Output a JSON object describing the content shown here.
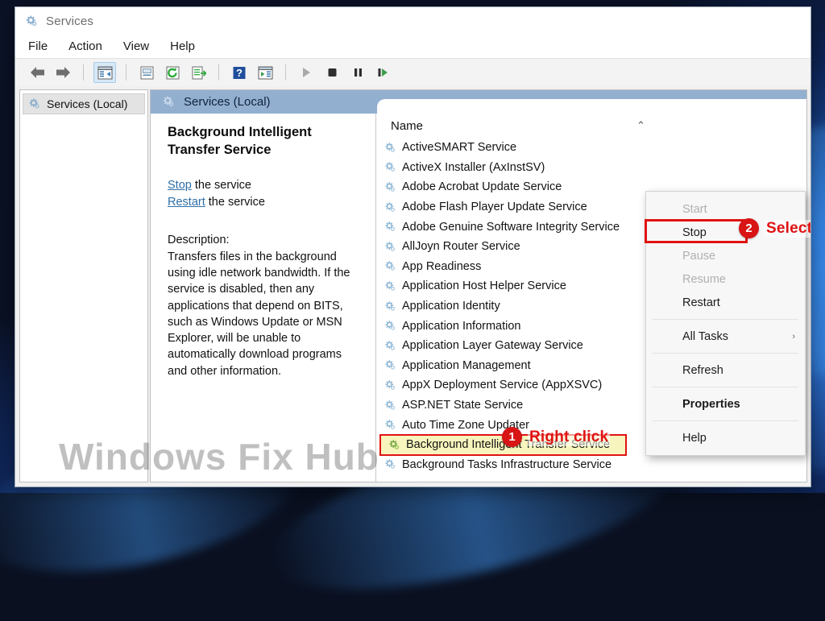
{
  "window": {
    "title": "Services",
    "title_icon": "services-gear-icon"
  },
  "menubar": {
    "items": [
      {
        "label": "File"
      },
      {
        "label": "Action"
      },
      {
        "label": "View"
      },
      {
        "label": "Help"
      }
    ]
  },
  "toolbar": {
    "buttons": [
      {
        "name": "back-arrow-icon",
        "label": "Back"
      },
      {
        "name": "forward-arrow-icon",
        "label": "Forward"
      },
      {
        "name": "show-hide-console-tree-icon",
        "label": "Show/Hide Console Tree"
      },
      {
        "name": "properties-icon",
        "label": "Properties"
      },
      {
        "name": "refresh-icon",
        "label": "Refresh"
      },
      {
        "name": "export-list-icon",
        "label": "Export List"
      },
      {
        "name": "help-icon",
        "label": "Help"
      },
      {
        "name": "show-action-pane-icon",
        "label": "Show/Hide Action Pane"
      },
      {
        "name": "start-service-icon",
        "label": "Start Service"
      },
      {
        "name": "stop-service-icon",
        "label": "Stop Service"
      },
      {
        "name": "pause-service-icon",
        "label": "Pause Service"
      },
      {
        "name": "restart-service-icon",
        "label": "Restart Service"
      }
    ]
  },
  "tree": {
    "items": [
      {
        "label": "Services (Local)",
        "icon": "services-gear-icon"
      }
    ]
  },
  "detail": {
    "tab_title": "Services (Local)",
    "tab_icon": "services-gear-icon",
    "service_title": "Background Intelligent Transfer Service",
    "links": [
      {
        "link": "Stop",
        "suffix": " the service"
      },
      {
        "link": "Restart",
        "suffix": " the service"
      }
    ],
    "description_label": "Description:",
    "description": "Transfers files in the background using idle network bandwidth. If the service is disabled, then any applications that depend on BITS, such as Windows Update or MSN Explorer, will be unable to automatically download programs and other information."
  },
  "list": {
    "column_header": "Name",
    "sort_indicator": "⌃",
    "rows": [
      {
        "name": "ActiveSMART Service",
        "highlighted": false
      },
      {
        "name": "ActiveX Installer (AxInstSV)",
        "highlighted": false
      },
      {
        "name": "Adobe Acrobat Update Service",
        "highlighted": false
      },
      {
        "name": "Adobe Flash Player Update Service",
        "highlighted": false
      },
      {
        "name": "Adobe Genuine Software Integrity Service",
        "highlighted": false
      },
      {
        "name": "AllJoyn Router Service",
        "highlighted": false
      },
      {
        "name": "App Readiness",
        "highlighted": false
      },
      {
        "name": "Application Host Helper Service",
        "highlighted": false
      },
      {
        "name": "Application Identity",
        "highlighted": false
      },
      {
        "name": "Application Information",
        "highlighted": false
      },
      {
        "name": "Application Layer Gateway Service",
        "highlighted": false
      },
      {
        "name": "Application Management",
        "highlighted": false
      },
      {
        "name": "AppX Deployment Service (AppXSVC)",
        "highlighted": false
      },
      {
        "name": "ASP.NET State Service",
        "highlighted": false
      },
      {
        "name": "Auto Time Zone Updater",
        "highlighted": false
      },
      {
        "name": "Background Intelligent Transfer Service",
        "highlighted": true
      },
      {
        "name": "Background Tasks Infrastructure Service",
        "highlighted": false
      }
    ]
  },
  "context_menu": {
    "items": [
      {
        "label": "Start",
        "state": "disabled",
        "separator_after": false
      },
      {
        "label": "Stop",
        "state": "enabled",
        "separator_after": false,
        "boxed": true
      },
      {
        "label": "Pause",
        "state": "disabled",
        "separator_after": false
      },
      {
        "label": "Resume",
        "state": "disabled",
        "separator_after": false
      },
      {
        "label": "Restart",
        "state": "enabled",
        "separator_after": true
      },
      {
        "label": "All Tasks",
        "state": "enabled",
        "submenu": true,
        "separator_after": true
      },
      {
        "label": "Refresh",
        "state": "enabled",
        "separator_after": true
      },
      {
        "label": "Properties",
        "state": "enabled",
        "bold": true,
        "separator_after": true
      },
      {
        "label": "Help",
        "state": "enabled",
        "separator_after": false
      }
    ]
  },
  "annotations": [
    {
      "number": "1",
      "text": "Right click"
    },
    {
      "number": "2",
      "text": "Select"
    }
  ],
  "watermark": "Windows Fix Hub",
  "colors": {
    "accent_red": "#e01313",
    "tab_blue": "#92afd0",
    "highlight_yellow": "#f7f5bd",
    "link_blue": "#2f6fa8"
  }
}
